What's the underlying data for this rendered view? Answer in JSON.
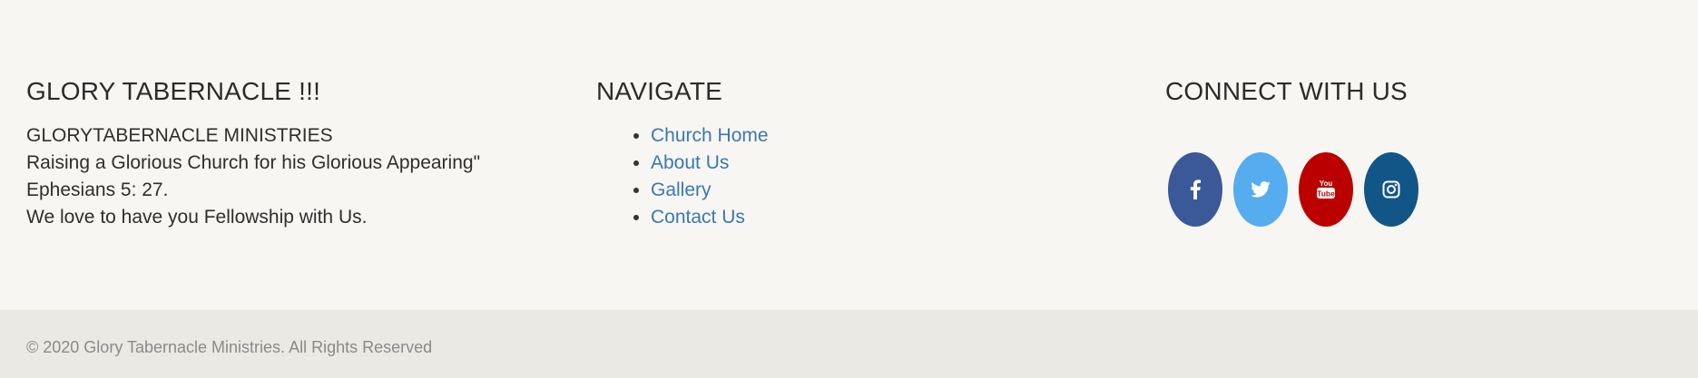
{
  "about": {
    "heading": "GLORY TABERNACLE !!!",
    "lines": [
      "GLORYTABERNACLE MINISTRIES",
      "Raising a Glorious Church for his Glorious Appearing\"",
      "Ephesians 5: 27.",
      "We love to have you Fellowship with Us."
    ]
  },
  "navigate": {
    "heading": "NAVIGATE",
    "links": [
      {
        "label": "Church Home"
      },
      {
        "label": "About Us"
      },
      {
        "label": "Gallery"
      },
      {
        "label": "Contact Us"
      }
    ]
  },
  "connect": {
    "heading": "CONNECT WITH US",
    "social": [
      {
        "name": "facebook-icon",
        "color": "#3b5998"
      },
      {
        "name": "twitter-icon",
        "color": "#55acee"
      },
      {
        "name": "youtube-icon",
        "color": "#bb0000"
      },
      {
        "name": "instagram-icon",
        "color": "#125688"
      }
    ]
  },
  "colors": {
    "link": "#3a78b0",
    "footer_bg": "#f8f6f3",
    "bottom_bar_bg": "#ebe9e4"
  },
  "copyright": "© 2020 Glory Tabernacle Ministries. All Rights Reserved"
}
